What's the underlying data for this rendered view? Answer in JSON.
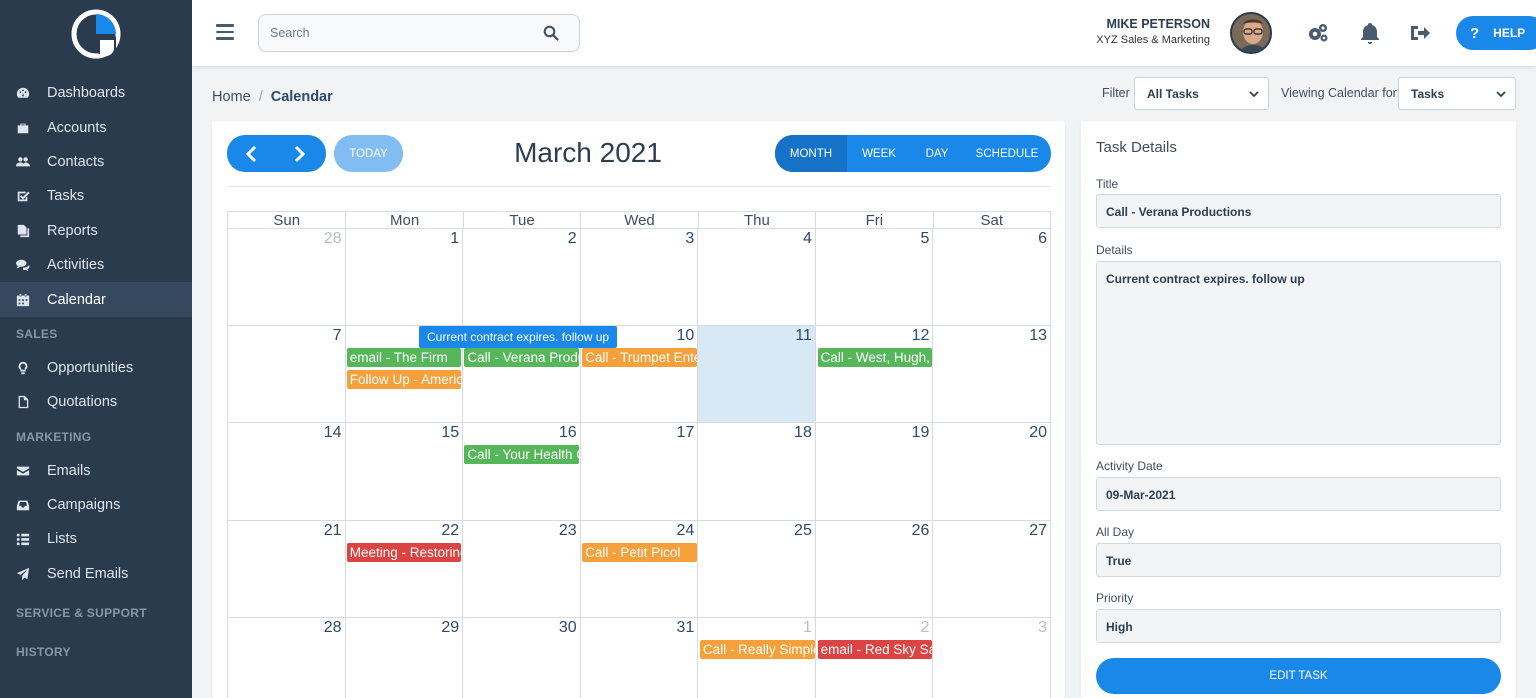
{
  "sidebar": {
    "items": [
      {
        "label": "Dashboards",
        "icon": "dashboard-icon"
      },
      {
        "label": "Accounts",
        "icon": "briefcase-icon"
      },
      {
        "label": "Contacts",
        "icon": "users-icon"
      },
      {
        "label": "Tasks",
        "icon": "checkbox-icon"
      },
      {
        "label": "Reports",
        "icon": "documents-icon"
      },
      {
        "label": "Activities",
        "icon": "comments-icon"
      },
      {
        "label": "Calendar",
        "icon": "calendar-icon"
      }
    ],
    "sales_header": "SALES",
    "sales_items": [
      {
        "label": "Opportunities",
        "icon": "lightbulb-icon"
      },
      {
        "label": "Quotations",
        "icon": "file-icon"
      }
    ],
    "marketing_header": "MARKETING",
    "marketing_items": [
      {
        "label": "Emails",
        "icon": "envelope-icon"
      },
      {
        "label": "Campaigns",
        "icon": "inbox-icon"
      },
      {
        "label": "Lists",
        "icon": "list-icon"
      },
      {
        "label": "Send Emails",
        "icon": "paper-plane-icon"
      }
    ],
    "service_header": "SERVICE & SUPPORT",
    "history_header": "HISTORY"
  },
  "topbar": {
    "search_placeholder": "Search",
    "user_name": "MIKE PETERSON",
    "user_company": "XYZ Sales & Marketing",
    "help_label": "HELP"
  },
  "breadcrumb": {
    "home": "Home",
    "separator": "/",
    "current": "Calendar"
  },
  "filters": {
    "filter_label": "Filter",
    "filter_value": "All Tasks",
    "viewing_label": "Viewing Calendar for:",
    "viewing_value": "Tasks"
  },
  "calendar": {
    "today_label": "TODAY",
    "title": "March 2021",
    "views": [
      "MONTH",
      "WEEK",
      "DAY",
      "SCHEDULE"
    ],
    "active_view": "MONTH",
    "weekdays": [
      "Sun",
      "Mon",
      "Tue",
      "Wed",
      "Thu",
      "Fri",
      "Sat"
    ],
    "weeks": [
      [
        {
          "n": "28",
          "other": true
        },
        {
          "n": "1"
        },
        {
          "n": "2"
        },
        {
          "n": "3"
        },
        {
          "n": "4"
        },
        {
          "n": "5"
        },
        {
          "n": "6"
        }
      ],
      [
        {
          "n": "7"
        },
        {
          "n": ""
        },
        {
          "n": ""
        },
        {
          "n": "10"
        },
        {
          "n": "11",
          "today": true
        },
        {
          "n": "12"
        },
        {
          "n": "13"
        }
      ],
      [
        {
          "n": "14"
        },
        {
          "n": "15"
        },
        {
          "n": "16"
        },
        {
          "n": "17"
        },
        {
          "n": "18"
        },
        {
          "n": "19"
        },
        {
          "n": "20"
        }
      ],
      [
        {
          "n": "21"
        },
        {
          "n": "22"
        },
        {
          "n": "23"
        },
        {
          "n": "24"
        },
        {
          "n": "25"
        },
        {
          "n": "26"
        },
        {
          "n": "27"
        }
      ],
      [
        {
          "n": "28"
        },
        {
          "n": "29"
        },
        {
          "n": "30"
        },
        {
          "n": "31"
        },
        {
          "n": "1",
          "other": true
        },
        {
          "n": "2",
          "other": true
        },
        {
          "n": "3",
          "other": true
        }
      ]
    ],
    "events": [
      {
        "week": 1,
        "day": 1,
        "slot": 0,
        "label": "email - The Firm",
        "color": "green"
      },
      {
        "week": 1,
        "day": 1,
        "slot": 1,
        "label": "Follow Up - American",
        "color": "orange"
      },
      {
        "week": 1,
        "day": 2,
        "slot": 0,
        "label": "Call - Verana Productions",
        "color": "green"
      },
      {
        "week": 1,
        "day": 3,
        "slot": 0,
        "label": "Call - Trumpet Enterprises",
        "color": "orange"
      },
      {
        "week": 1,
        "day": 5,
        "slot": 0,
        "label": "Call - West, Hugh, and Co",
        "color": "green"
      },
      {
        "week": 2,
        "day": 2,
        "slot": 0,
        "label": "Call - Your Health Clinic",
        "color": "green"
      },
      {
        "week": 3,
        "day": 1,
        "slot": 0,
        "label": "Meeting - Restoring",
        "color": "red"
      },
      {
        "week": 3,
        "day": 3,
        "slot": 0,
        "label": "Call - Petit Picol",
        "color": "orange"
      },
      {
        "week": 4,
        "day": 4,
        "slot": 0,
        "label": "Call - Really Simple",
        "color": "orange"
      },
      {
        "week": 4,
        "day": 5,
        "slot": 0,
        "label": "email - Red Sky Sails",
        "color": "red"
      }
    ],
    "tooltip": "Current contract expires. follow up",
    "event_colors": {
      "green": "#56b75a",
      "orange": "#f5a03b",
      "red": "#dc4343"
    }
  },
  "task": {
    "header": "Task Details",
    "title_label": "Title",
    "title_value": "Call - Verana Productions",
    "details_label": "Details",
    "details_value": "Current contract expires. follow up",
    "date_label": "Activity Date",
    "date_value": "09-Mar-2021",
    "allday_label": "All Day",
    "allday_value": "True",
    "priority_label": "Priority",
    "priority_value": "High",
    "edit_label": "EDIT TASK"
  },
  "colors": {
    "sidebar_bg": "#2b3b4e",
    "accent": "#1a88e8",
    "today_bg": "#d8e8f5"
  }
}
